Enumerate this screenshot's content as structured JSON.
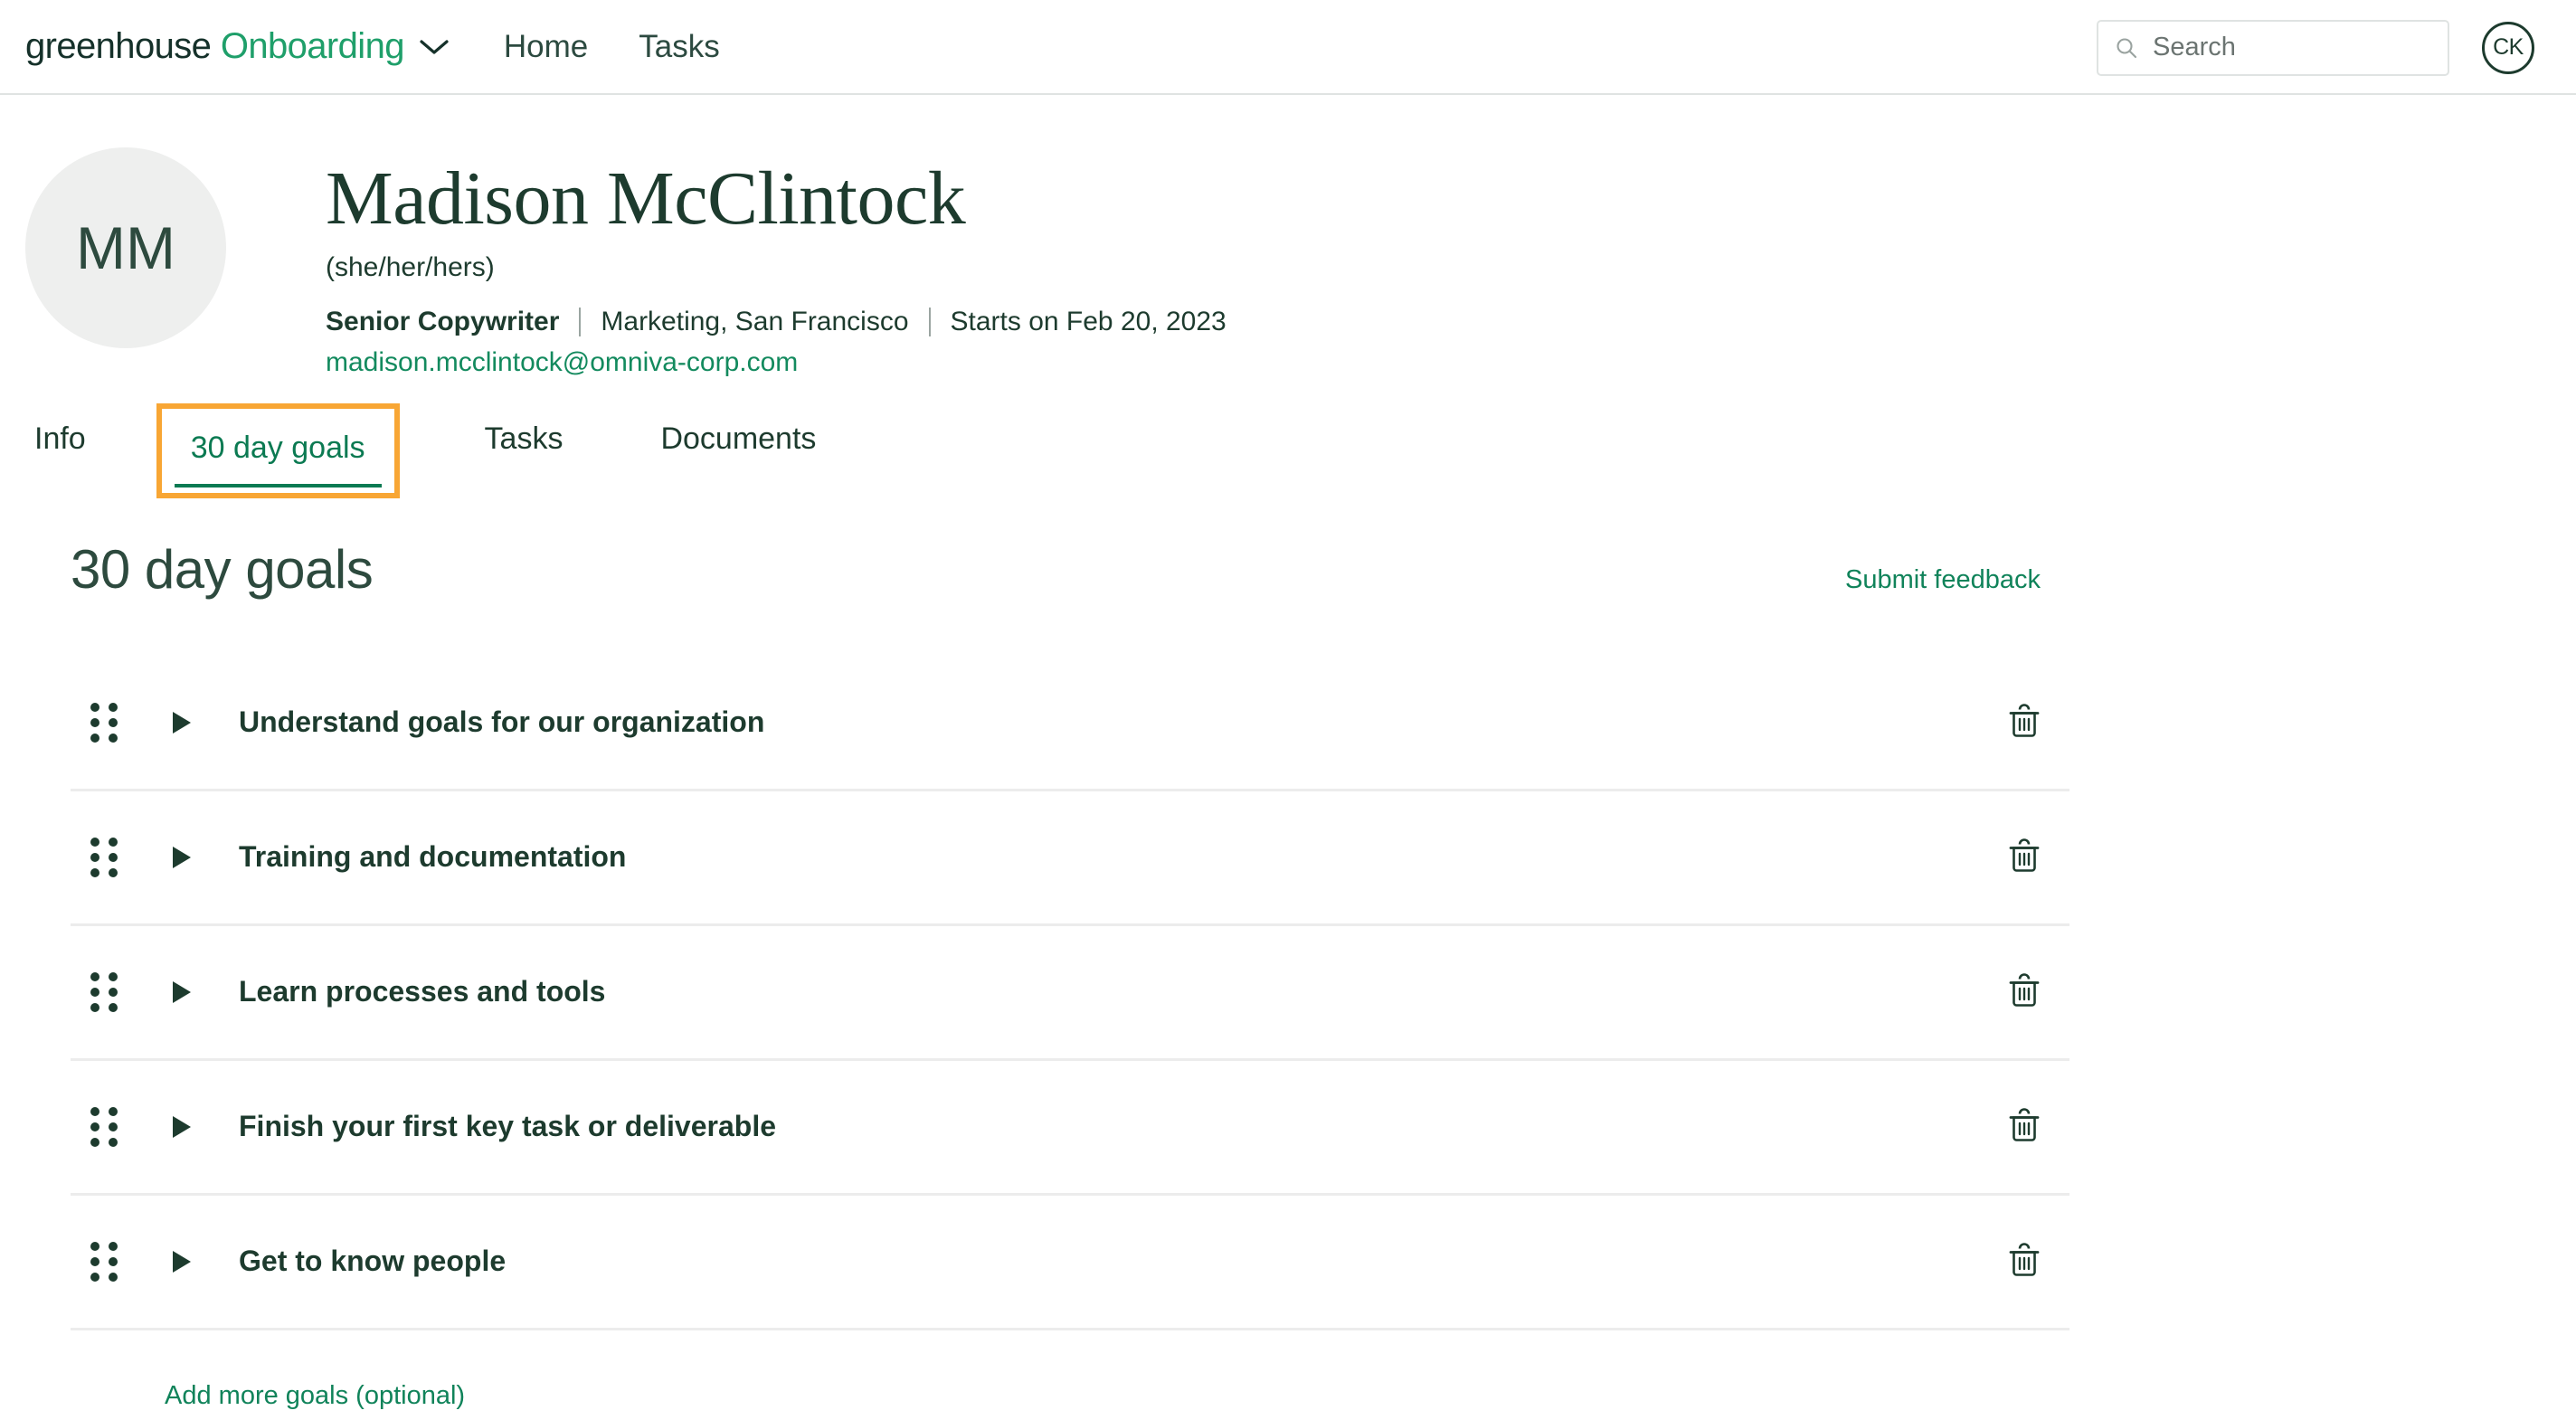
{
  "topbar": {
    "brand_primary": "greenhouse",
    "brand_secondary": "Onboarding",
    "brand_menu_icon": "chevron-down-icon",
    "nav": [
      {
        "label": "Home"
      },
      {
        "label": "Tasks"
      }
    ],
    "search": {
      "icon": "search-icon",
      "placeholder": "Search",
      "value": ""
    },
    "user_avatar_initials": "CK"
  },
  "profile": {
    "avatar_initials": "MM",
    "name": "Madison McClintock",
    "pronouns": "(she/her/hers)",
    "role": "Senior Copywriter",
    "department_location": "Marketing, San Francisco",
    "start_date": "Starts on Feb 20, 2023",
    "email": "madison.mcclintock@omniva-corp.com"
  },
  "tabs": [
    {
      "label": "Info",
      "active": false,
      "highlighted": false
    },
    {
      "label": "30 day goals",
      "active": true,
      "highlighted": true
    },
    {
      "label": "Tasks",
      "active": false,
      "highlighted": false
    },
    {
      "label": "Documents",
      "active": false,
      "highlighted": false
    }
  ],
  "goals_section": {
    "title": "30 day goals",
    "feedback_link": "Submit feedback",
    "add_link": "Add more goals (optional)",
    "goals": [
      {
        "title": "Understand goals for our organization",
        "expanded": false
      },
      {
        "title": "Training and documentation",
        "expanded": false
      },
      {
        "title": "Learn processes and tools",
        "expanded": false
      },
      {
        "title": "Finish your first key task or deliverable",
        "expanded": false
      },
      {
        "title": "Get to know people",
        "expanded": false
      }
    ]
  },
  "colors": {
    "brand_green": "#1f9f6a",
    "brand_dark": "#15312a",
    "text_dark_green": "#1d3b2e",
    "link_green": "#10835a",
    "active_tab_green": "#0b7a52",
    "highlight_orange": "#f8a634",
    "avatar_bg": "#eeefee",
    "divider": "#ececec"
  }
}
